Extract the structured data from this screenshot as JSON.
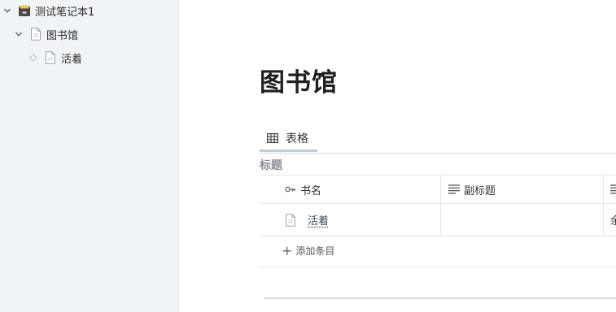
{
  "sidebar": {
    "notebook": {
      "label": "测试笔记本1",
      "icon": "notebook-icon"
    },
    "items": [
      {
        "label": "图书馆",
        "icon": "document-icon",
        "expanded": true
      },
      {
        "label": "活着",
        "icon": "document-icon",
        "leaf": true
      }
    ]
  },
  "page": {
    "title": "图书馆"
  },
  "views": {
    "tabs": [
      {
        "label": "表格",
        "icon": "table-icon",
        "active": true
      }
    ]
  },
  "group": {
    "title": "标题"
  },
  "table": {
    "columns": [
      {
        "label": "书名",
        "icon": "key-icon"
      },
      {
        "label": "副标题",
        "icon": "text-lines-icon"
      },
      {
        "label": "",
        "icon": "text-lines-icon"
      }
    ],
    "rows": [
      {
        "cells": [
          "活着",
          "",
          "余"
        ]
      }
    ],
    "add_label": "添加条目"
  },
  "colors": {
    "sidebar_bg": "#f1f4f7",
    "border": "#e3e6ea",
    "tab_underline": "#c3cdd8"
  }
}
